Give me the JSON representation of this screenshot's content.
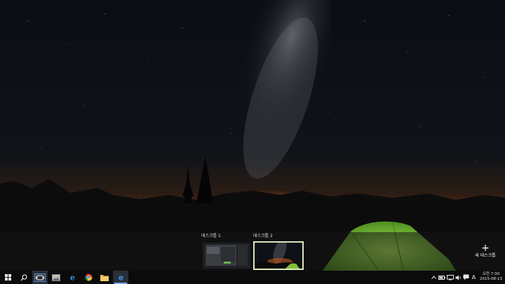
{
  "task_view": {
    "desktops": [
      {
        "label": "데스크톱 1",
        "active": false
      },
      {
        "label": "데스크톱 2",
        "active": true
      }
    ],
    "new_desktop_label": "새 데스크톱"
  },
  "taskbar": {
    "pinned": [
      {
        "name": "start-button",
        "icon": "windows-logo-icon"
      },
      {
        "name": "search-button",
        "icon": "search-icon"
      },
      {
        "name": "task-view-button",
        "icon": "task-view-icon",
        "active": true
      },
      {
        "name": "photos-app",
        "icon": "photos-icon"
      },
      {
        "name": "internet-explorer",
        "icon": "ie-icon"
      },
      {
        "name": "chrome",
        "icon": "chrome-icon"
      },
      {
        "name": "file-explorer",
        "icon": "folder-icon"
      },
      {
        "name": "edge",
        "icon": "edge-icon",
        "running": true
      }
    ],
    "tray": {
      "input_indicator": "A",
      "clock_time": "오전 7:30",
      "clock_date": "2015-08-13"
    }
  },
  "colors": {
    "accent": "#79a7e6",
    "active_desktop_border": "#d9e8c0",
    "tent": "#7dc23a",
    "horizon_glow": "#c25a1c"
  }
}
